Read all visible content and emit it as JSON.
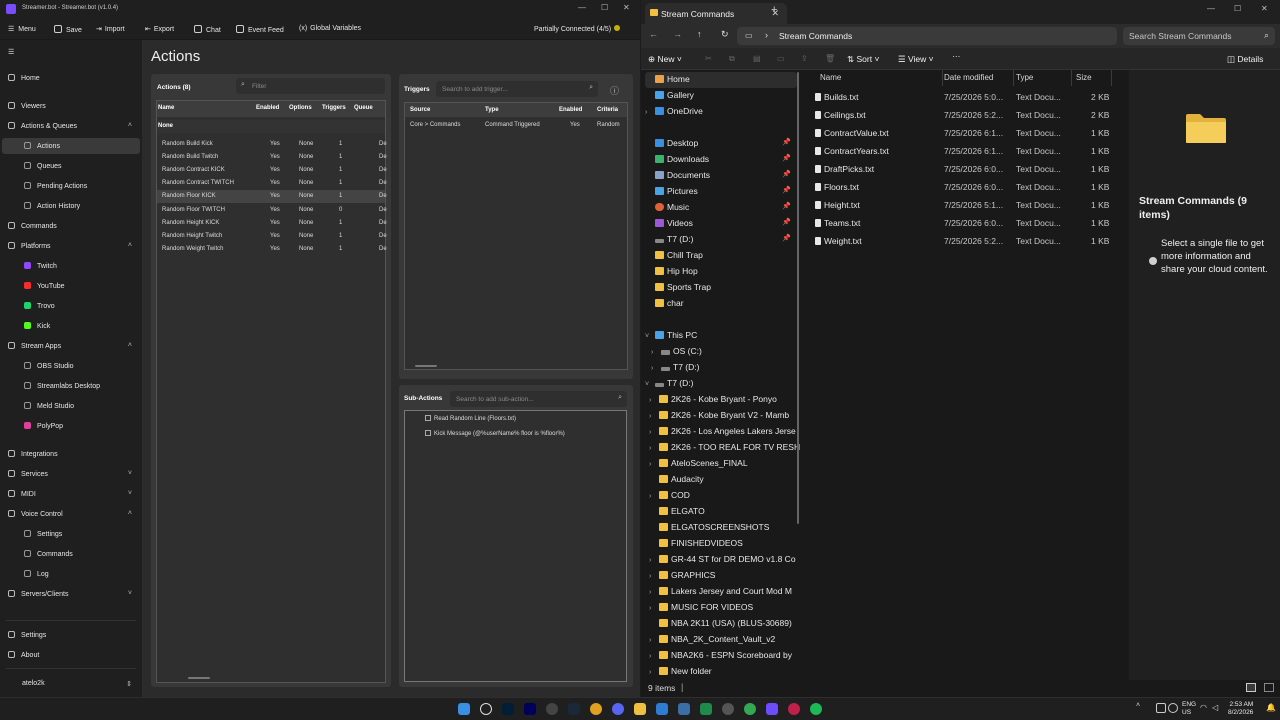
{
  "streamerbot": {
    "title": "Streamer.bot - Streamer.bot (v1.0.4)",
    "menu": {
      "menu": "Menu",
      "save": "Save",
      "import": "Import",
      "export": "Export",
      "chat": "Chat",
      "event_feed": "Event Feed",
      "global_variables": "Global Variables"
    },
    "connection_status": "Partially Connected (4/5)",
    "sidebar": {
      "home": "Home",
      "viewers": "Viewers",
      "actions_queues": "Actions & Queues",
      "actions": "Actions",
      "queues": "Queues",
      "pending_actions": "Pending Actions",
      "action_history": "Action History",
      "commands": "Commands",
      "platforms": "Platforms",
      "twitch": "Twitch",
      "youtube": "YouTube",
      "trovo": "Trovo",
      "kick": "Kick",
      "stream_apps": "Stream Apps",
      "obs_studio": "OBS Studio",
      "streamlabs_desktop": "Streamlabs Desktop",
      "meld_studio": "Meld Studio",
      "polypop": "PolyPop",
      "integrations": "Integrations",
      "services": "Services",
      "midi": "MIDI",
      "voice_control": "Voice Control",
      "vc_settings": "Settings",
      "vc_commands": "Commands",
      "vc_log": "Log",
      "servers_clients": "Servers/Clients",
      "settings": "Settings",
      "about": "About",
      "user": "atelo2k"
    },
    "page_title": "Actions",
    "actions_panel": {
      "title": "Actions (8)",
      "filter_placeholder": "Filter",
      "columns": [
        "Name",
        "Enabled",
        "Options",
        "Triggers",
        "Queue"
      ],
      "group": "None",
      "rows": [
        {
          "name": "Random Build Kick",
          "enabled": "Yes",
          "options": "None",
          "triggers": "1",
          "queue": "De"
        },
        {
          "name": "Random Build Twitch",
          "enabled": "Yes",
          "options": "None",
          "triggers": "1",
          "queue": "De"
        },
        {
          "name": "Random Contract KICK",
          "enabled": "Yes",
          "options": "None",
          "triggers": "1",
          "queue": "De"
        },
        {
          "name": "Random Contract TWITCH",
          "enabled": "Yes",
          "options": "None",
          "triggers": "1",
          "queue": "De"
        },
        {
          "name": "Random Floor KICK",
          "enabled": "Yes",
          "options": "None",
          "triggers": "1",
          "queue": "De"
        },
        {
          "name": "Random Floor TWITCH",
          "enabled": "Yes",
          "options": "None",
          "triggers": "0",
          "queue": "De"
        },
        {
          "name": "Random Height KICK",
          "enabled": "Yes",
          "options": "None",
          "triggers": "1",
          "queue": "De"
        },
        {
          "name": "Random Height Twitch",
          "enabled": "Yes",
          "options": "None",
          "triggers": "1",
          "queue": "De"
        },
        {
          "name": "Random Weight Twitch",
          "enabled": "Yes",
          "options": "None",
          "triggers": "1",
          "queue": "De"
        }
      ]
    },
    "triggers_panel": {
      "title": "Triggers",
      "search_placeholder": "Search to add trigger...",
      "columns": [
        "Source",
        "Type",
        "Enabled",
        "Criteria"
      ],
      "row": {
        "source": "Core > Commands",
        "type": "Command Triggered",
        "enabled": "Yes",
        "criteria": "Random"
      }
    },
    "subactions_panel": {
      "title": "Sub-Actions",
      "search_placeholder": "Search to add sub-action...",
      "items": [
        "Read Random Line (Floors.txt)",
        "Kick Message (@%userName% floor is %floor%)"
      ]
    }
  },
  "explorer": {
    "tab_title": "Stream Commands",
    "breadcrumb": "Stream Commands",
    "search_placeholder": "Search Stream Commands",
    "toolbar": {
      "new": "New",
      "sort": "Sort",
      "view": "View",
      "more": "···",
      "details": "Details"
    },
    "nav": {
      "home": "Home",
      "gallery": "Gallery",
      "onedrive": "OneDrive",
      "quick": [
        "Desktop",
        "Downloads",
        "Documents",
        "Pictures",
        "Music",
        "Videos",
        "T7 (D:)"
      ],
      "folders": [
        "Chill Trap",
        "Hip Hop",
        "Sports Trap",
        "char"
      ],
      "this_pc": "This PC",
      "drives": [
        "OS (C:)",
        "T7 (D:)"
      ],
      "t7": "T7 (D:)",
      "t7_children": [
        "2K26 - Kobe Bryant - Ponyo",
        "2K26 - Kobe Bryant V2 - Mamb",
        "2K26 - Los Angeles Lakers Jerse",
        "2K26 - TOO REAL FOR TV RESH",
        "AteloScenes_FINAL",
        "Audacity",
        "COD",
        "ELGATO",
        "ELGATOSCREENSHOTS",
        "FINISHEDVIDEOS",
        "GR-44 ST for DR DEMO v1.8 Co",
        "GRAPHICS",
        "Lakers Jersey and Court Mod M",
        "MUSIC FOR VIDEOS",
        "NBA 2K11 (USA) (BLUS-30689)",
        "NBA_2K_Content_Vault_v2",
        "NBA2K6 - ESPN Scoreboard by",
        "New folder"
      ]
    },
    "columns": [
      "Name",
      "Date modified",
      "Type",
      "Size"
    ],
    "files": [
      {
        "name": "Builds.txt",
        "date": "7/25/2026 5:0...",
        "type": "Text Docu...",
        "size": "2 KB"
      },
      {
        "name": "Ceilings.txt",
        "date": "7/25/2026 5:2...",
        "type": "Text Docu...",
        "size": "2 KB"
      },
      {
        "name": "ContractValue.txt",
        "date": "7/25/2026 6:1...",
        "type": "Text Docu...",
        "size": "1 KB"
      },
      {
        "name": "ContractYears.txt",
        "date": "7/25/2026 6:1...",
        "type": "Text Docu...",
        "size": "1 KB"
      },
      {
        "name": "DraftPicks.txt",
        "date": "7/25/2026 6:0...",
        "type": "Text Docu...",
        "size": "1 KB"
      },
      {
        "name": "Floors.txt",
        "date": "7/25/2026 6:0...",
        "type": "Text Docu...",
        "size": "1 KB"
      },
      {
        "name": "Height.txt",
        "date": "7/25/2026 5:1...",
        "type": "Text Docu...",
        "size": "1 KB"
      },
      {
        "name": "Teams.txt",
        "date": "7/25/2026 6:0...",
        "type": "Text Docu...",
        "size": "1 KB"
      },
      {
        "name": "Weight.txt",
        "date": "7/25/2026 5:2...",
        "type": "Text Docu...",
        "size": "1 KB"
      }
    ],
    "details_title": "Stream Commands (9 items)",
    "details_message": "Select a single file to get more information and share your cloud content.",
    "status": "9 items"
  },
  "taskbar": {
    "lang": "ENG",
    "region": "US",
    "time": "2:53 AM",
    "date": "8/2/2026"
  },
  "colors": {
    "accent": "#7a4cff",
    "folder": "#f0c043",
    "connection": "#c8b400"
  }
}
